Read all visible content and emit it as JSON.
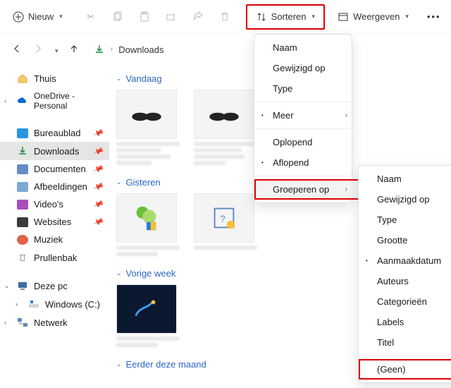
{
  "toolbar": {
    "new": "Nieuw",
    "sort": "Sorteren",
    "view": "Weergeven"
  },
  "path": {
    "current": "Downloads"
  },
  "sidebar": {
    "home": "Thuis",
    "onedrive": "OneDrive - Personal",
    "quick": [
      "Bureaublad",
      "Downloads",
      "Documenten",
      "Afbeeldingen",
      "Video's",
      "Websites",
      "Muziek",
      "Prullenbak"
    ],
    "thispc": "Deze pc",
    "drive": "Windows (C:)",
    "network": "Netwerk"
  },
  "groups": {
    "today": "Vandaag",
    "yesterday": "Gisteren",
    "lastweek": "Vorige week",
    "earliermonth": "Eerder deze maand"
  },
  "sortMenu": {
    "name": "Naam",
    "modified": "Gewijzigd op",
    "type": "Type",
    "more": "Meer",
    "asc": "Oplopend",
    "desc": "Aflopend",
    "groupby": "Groeperen op"
  },
  "groupMenu": {
    "name": "Naam",
    "modified": "Gewijzigd op",
    "type": "Type",
    "size": "Grootte",
    "created": "Aanmaakdatum",
    "authors": "Auteurs",
    "categories": "Categorieën",
    "labels": "Labels",
    "title": "Titel",
    "none": "(Geen)"
  }
}
